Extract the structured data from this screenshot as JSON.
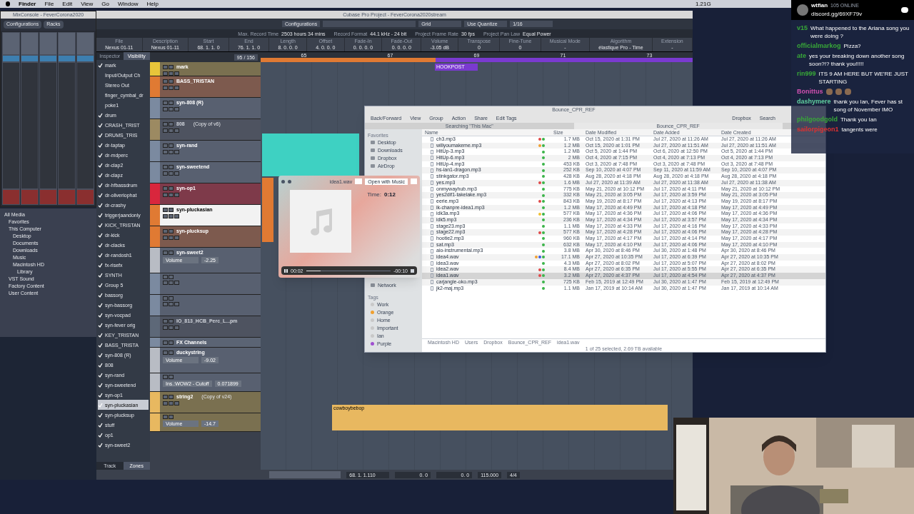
{
  "menu_bar": {
    "items": [
      "Finder",
      "File",
      "Edit",
      "View",
      "Go",
      "Window",
      "Help"
    ],
    "status": "1.21G"
  },
  "mix_console": {
    "title": "MixConsole - FeverCorona2020",
    "toolbar": [
      "Configurations",
      "Racks"
    ]
  },
  "media_browser": {
    "items": [
      {
        "label": "All Media",
        "children": [
          {
            "label": "Favorites"
          },
          {
            "label": "This Computer",
            "children": [
              {
                "label": "Desktop"
              },
              {
                "label": "Documents"
              },
              {
                "label": "Downloads"
              },
              {
                "label": "Music"
              },
              {
                "label": "Macintosh HD",
                "children": [
                  {
                    "label": "Library"
                  }
                ]
              }
            ]
          },
          {
            "label": "VST Sound"
          },
          {
            "label": "Factory Content"
          },
          {
            "label": "User Content"
          }
        ]
      }
    ]
  },
  "project": {
    "title": "Cubase Pro Project - FeverCorona2020stream",
    "toolbar": {
      "configurations": "Configurations",
      "grid": "Grid",
      "quantize": "Use Quantize",
      "quantize_value": "1/16"
    },
    "status_line": [
      {
        "label": "Max. Record Time",
        "value": "2503 hours 34 mins"
      },
      {
        "label": "Record Format",
        "value": "44.1 kHz - 24 bit"
      },
      {
        "label": "Project Frame Rate",
        "value": "30 fps"
      },
      {
        "label": "Project Pan Law",
        "value": "Equal Power"
      }
    ],
    "info_line": [
      {
        "label": "File",
        "value": "Nexus 01-11"
      },
      {
        "label": "Description",
        "value": "Nexus 01-11"
      },
      {
        "label": "Start",
        "value": "68. 1. 1. 0"
      },
      {
        "label": "End",
        "value": "76. 1. 1. 0"
      },
      {
        "label": "Length",
        "value": "8. 0. 0. 0"
      },
      {
        "label": "Offset",
        "value": "4. 0. 0. 0"
      },
      {
        "label": "Fade-In",
        "value": "0. 0. 0. 0"
      },
      {
        "label": "Fade-Out",
        "value": "0. 0. 0. 0"
      },
      {
        "label": "Volume",
        "value": "-3.05 dB"
      },
      {
        "label": "Transpose",
        "value": "0"
      },
      {
        "label": "Fine-Tune",
        "value": "0"
      },
      {
        "label": "Musical Mode",
        "value": "-"
      },
      {
        "label": "Algorithm",
        "value": "élastique Pro - Time"
      },
      {
        "label": "Extension",
        "value": "-"
      }
    ],
    "inspector_tabs": [
      {
        "label": "Inspector",
        "selected": false
      },
      {
        "label": "Visibility",
        "selected": true
      }
    ],
    "visibility": [
      {
        "name": "mark",
        "checked": true,
        "selected": false
      },
      {
        "name": "Input/Output Ch",
        "checked": false,
        "selected": false
      },
      {
        "name": "Stereo Out",
        "checked": false,
        "selected": false
      },
      {
        "name": "finger_cymbal_dr",
        "checked": false,
        "selected": false
      },
      {
        "name": "poke1",
        "checked": false,
        "selected": false
      },
      {
        "name": "drum",
        "checked": true,
        "selected": false
      },
      {
        "name": "CRASH_TRIST",
        "checked": true,
        "selected": false
      },
      {
        "name": "DRUMS_TRIS",
        "checked": true,
        "selected": false
      },
      {
        "name": "dr-taptap",
        "checked": true,
        "selected": false
      },
      {
        "name": "dr-mdperc",
        "checked": true,
        "selected": false
      },
      {
        "name": "dr-clap2",
        "checked": true,
        "selected": false
      },
      {
        "name": "dr-clapz",
        "checked": true,
        "selected": false
      },
      {
        "name": "dr-hfbassdrum",
        "checked": true,
        "selected": false
      },
      {
        "name": "dr-oliveriophat",
        "checked": true,
        "selected": false
      },
      {
        "name": "dr-crashy",
        "checked": true,
        "selected": false
      },
      {
        "name": "triggerjaandonly",
        "checked": true,
        "selected": false
      },
      {
        "name": "KICK_TRISTAN",
        "checked": true,
        "selected": false
      },
      {
        "name": "dr-kick",
        "checked": true,
        "selected": false
      },
      {
        "name": "dr-clacks",
        "checked": true,
        "selected": false
      },
      {
        "name": "dr-randosh1",
        "checked": true,
        "selected": false
      },
      {
        "name": "fx-risefx",
        "checked": true,
        "selected": false
      },
      {
        "name": "SYNTH",
        "checked": true,
        "selected": false
      },
      {
        "name": "Group 5",
        "checked": true,
        "selected": false
      },
      {
        "name": "bassorg",
        "checked": true,
        "selected": false
      },
      {
        "name": "syn-bassorg",
        "checked": true,
        "selected": false
      },
      {
        "name": "syn-vocpad",
        "checked": true,
        "selected": false
      },
      {
        "name": "syn-fever orig",
        "checked": true,
        "selected": false
      },
      {
        "name": "KEY_TRISTAN",
        "checked": true,
        "selected": false
      },
      {
        "name": "BASS_TRISTA",
        "checked": true,
        "selected": false
      },
      {
        "name": "syn-808 (R)",
        "checked": true,
        "selected": false
      },
      {
        "name": "808",
        "checked": true,
        "selected": false
      },
      {
        "name": "syn-rand",
        "checked": true,
        "selected": false
      },
      {
        "name": "syn-sweetend",
        "checked": true,
        "selected": false
      },
      {
        "name": "syn-op1",
        "checked": true,
        "selected": false
      },
      {
        "name": "syn-pluckasian",
        "checked": true,
        "selected": true
      },
      {
        "name": "syn-plucksup",
        "checked": true,
        "selected": false
      },
      {
        "name": "stuff",
        "checked": true,
        "selected": false
      },
      {
        "name": "op1",
        "checked": true,
        "selected": false
      },
      {
        "name": "syn-sweet2",
        "checked": true,
        "selected": false
      }
    ],
    "bottom_tabs": [
      {
        "label": "Track",
        "selected": false
      },
      {
        "label": "Zones",
        "selected": true
      }
    ],
    "track_counter": "95 / 156",
    "tracks": [
      {
        "kind": "marker",
        "name": "mark",
        "color": "#e8c53a",
        "selected": false
      },
      {
        "kind": "audio",
        "name": "BASS_TRISTAN",
        "color": "#e07a33",
        "selected": false
      },
      {
        "kind": "instrument",
        "name": "syn-808 (R)",
        "color": "#7b8aa0",
        "selected": false
      },
      {
        "kind": "disabled",
        "name": "808",
        "note": "(Copy of v6)",
        "color": "#9c8a62",
        "selected": false
      },
      {
        "kind": "instrument",
        "name": "syn-rand",
        "color": "#7b8aa0",
        "selected": false
      },
      {
        "kind": "instrument",
        "name": "syn-sweetend",
        "color": "#7b8aa0",
        "selected": false
      },
      {
        "kind": "instrument",
        "name": "syn-op1",
        "color": "#d9263d",
        "selected": false
      },
      {
        "kind": "instrument",
        "name": "syn-pluckasian",
        "color": "#e07a33",
        "selected": true
      },
      {
        "kind": "instrument",
        "name": "syn-plucksup",
        "color": "#e07a33",
        "selected": false
      },
      {
        "kind": "automation",
        "name": "syn-sweet2",
        "param": "Volume",
        "value": "-2.25",
        "color": "#b8bcc4",
        "selected": false
      },
      {
        "kind": "instrument",
        "color": "#7b8aa0",
        "selected": false
      },
      {
        "kind": "instrument",
        "color": "#7b8aa0",
        "selected": false
      },
      {
        "kind": "disabled",
        "name": "IO_813_HCB_Perc_L...pm",
        "color": "#5d6878",
        "selected": false
      },
      {
        "kind": "folder",
        "name": "FX Channels",
        "color": "#7b8aa0",
        "selected": false
      },
      {
        "kind": "automation",
        "name": "duckystring",
        "param": "Volume",
        "value": "-9.02",
        "color": "#b8bcc4",
        "selected": false
      },
      {
        "kind": "param",
        "param": "Ins.:WOW2 - Cutoff",
        "value": "0.071899",
        "color": "#b8bcc4",
        "selected": false
      },
      {
        "kind": "audio",
        "name": "string2",
        "note": "(Copy of v24)",
        "color": "#e8b860",
        "selected": false
      },
      {
        "kind": "param",
        "param": "Volume",
        "value": "-14.7",
        "color": "#e8b860",
        "selected": false
      }
    ],
    "ruler": [
      "65",
      "67",
      "69",
      "71",
      "73"
    ],
    "clips": [
      {
        "name": "HOOKPOST"
      },
      {
        "name": "cowboybebop"
      }
    ],
    "transport": {
      "position": "68. 1. 1.110",
      "field_a": "0. 0",
      "field_b": "0. 0",
      "tempo": "115.000",
      "signature": "4/4"
    }
  },
  "finder": {
    "title": "Bounce_CPR_REF",
    "toolbar": [
      "Back/Forward",
      "View",
      "Group",
      "Action",
      "Share",
      "Edit Tags",
      "Dropbox",
      "Search"
    ],
    "scope": "Searching \"This Mac\"",
    "tab": "Bounce_CPR_REF",
    "sidebar": [
      {
        "section": "Favorites",
        "items": [
          {
            "label": "Desktop"
          },
          {
            "label": "Downloads"
          },
          {
            "label": "Dropbox"
          },
          {
            "label": "AirDrop"
          },
          {
            "label": "Network"
          }
        ]
      },
      {
        "section": "Tags",
        "items": [
          {
            "label": "Work",
            "color": "#c8c8c8"
          },
          {
            "label": "Orange",
            "color": "#f0a030"
          },
          {
            "label": "Home",
            "color": "#c8c8c8"
          },
          {
            "label": "Important",
            "color": "#c8c8c8"
          },
          {
            "label": "Ian",
            "color": "#c8c8c8"
          },
          {
            "label": "Purple",
            "color": "#a050d0"
          }
        ]
      }
    ],
    "columns": [
      "Name",
      "Size",
      "Date Modified",
      "Date Added",
      "Date Created"
    ],
    "files": [
      {
        "name": "ch3.mp3",
        "tags": [
          {
            "color": "#e04848"
          },
          {
            "color": "#3cb44a"
          }
        ],
        "size": "1.7 MB",
        "modified": "Oct 15, 2020 at 1:31 PM",
        "added": "Jul 27, 2020 at 11:26 AM",
        "created": "Jul 27, 2020 at 11:26 AM",
        "selected": false
      },
      {
        "name": "willyoumakeme.mp3",
        "tags": [
          {
            "color": "#f0a030"
          },
          {
            "color": "#3cb44a"
          }
        ],
        "size": "1.2 MB",
        "modified": "Oct 15, 2020 at 1:01 PM",
        "added": "Jul 27, 2020 at 11:51 AM",
        "created": "Jul 27, 2020 at 11:51 AM",
        "selected": false
      },
      {
        "name": "HitUp-3.mp3",
        "tags": [
          {
            "color": "#3cb44a"
          }
        ],
        "size": "1.2 MB",
        "modified": "Oct 5, 2020 at 1:44 PM",
        "added": "Oct 6, 2020 at 12:50 PM",
        "created": "Oct 5, 2020 at 1:44 PM",
        "selected": false
      },
      {
        "name": "HitUp-6.mp3",
        "tags": [
          {
            "color": "#3cb44a"
          }
        ],
        "size": "2 MB",
        "modified": "Oct 4, 2020 at 7:15 PM",
        "added": "Oct 4, 2020 at 7:13 PM",
        "created": "Oct 4, 2020 at 7:13 PM",
        "selected": false
      },
      {
        "name": "HitUp-4.mp3",
        "tags": [
          {
            "color": "#3cb44a"
          }
        ],
        "size": "453 KB",
        "modified": "Oct 3, 2020 at 7:48 PM",
        "added": "Oct 3, 2020 at 7:48 PM",
        "created": "Oct 3, 2020 at 7:48 PM",
        "selected": false
      },
      {
        "name": "hs-ian1-dragon.mp3",
        "tags": [
          {
            "color": "#3cb44a"
          }
        ],
        "size": "252 KB",
        "modified": "Sep 10, 2020 at 4:07 PM",
        "added": "Sep 11, 2020 at 11:59 AM",
        "created": "Sep 10, 2020 at 4:07 PM",
        "selected": false
      },
      {
        "name": "stinkgator.mp3",
        "tags": [
          {
            "color": "#3cb44a"
          }
        ],
        "size": "428 KB",
        "modified": "Aug 28, 2020 at 4:18 PM",
        "added": "Aug 28, 2020 at 4:18 PM",
        "created": "Aug 28, 2020 at 4:18 PM",
        "selected": false
      },
      {
        "name": "yes.mp3",
        "tags": [
          {
            "color": "#e04848"
          },
          {
            "color": "#3cb44a"
          }
        ],
        "size": "1.6 MB",
        "modified": "Jul 27, 2020 at 11:39 AM",
        "added": "Jul 27, 2020 at 11:38 AM",
        "created": "Jul 27, 2020 at 11:38 AM",
        "selected": false
      },
      {
        "name": "onmywayhub.mp3",
        "tags": [
          {
            "color": "#3cb44a"
          }
        ],
        "size": "775 KB",
        "modified": "May 21, 2020 at 10:12 PM",
        "added": "Jul 17, 2020 at 4:11 PM",
        "created": "May 21, 2020 at 10:12 PM",
        "selected": false
      },
      {
        "name": "yes2dif1-takelake.mp3",
        "tags": [
          {
            "color": "#3cb44a"
          }
        ],
        "size": "332 KB",
        "modified": "May 21, 2020 at 3:05 PM",
        "added": "Jul 17, 2020 at 3:59 PM",
        "created": "May 21, 2020 at 3:05 PM",
        "selected": false
      },
      {
        "name": "eerie.mp3",
        "tags": [
          {
            "color": "#e04848"
          },
          {
            "color": "#3cb44a"
          }
        ],
        "size": "843 KB",
        "modified": "May 19, 2020 at 8:17 PM",
        "added": "Jul 17, 2020 at 4:13 PM",
        "created": "May 19, 2020 at 8:17 PM",
        "selected": false
      },
      {
        "name": "ik-chanpre-idea1.mp3",
        "tags": [
          {
            "color": "#3cb44a"
          }
        ],
        "size": "1.2 MB",
        "modified": "May 17, 2020 at 4:49 PM",
        "added": "Jul 17, 2020 at 4:18 PM",
        "created": "May 17, 2020 at 4:49 PM",
        "selected": false
      },
      {
        "name": "idk3a.mp3",
        "tags": [
          {
            "color": "#f0c030"
          },
          {
            "color": "#3cb44a"
          }
        ],
        "size": "577 KB",
        "modified": "May 17, 2020 at 4:36 PM",
        "added": "Jul 17, 2020 at 4:06 PM",
        "created": "May 17, 2020 at 4:36 PM",
        "selected": false
      },
      {
        "name": "idk5.mp3",
        "tags": [
          {
            "color": "#3cb44a"
          }
        ],
        "size": "236 KB",
        "modified": "May 17, 2020 at 4:34 PM",
        "added": "Jul 17, 2020 at 3:57 PM",
        "created": "May 17, 2020 at 4:34 PM",
        "selected": false
      },
      {
        "name": "stage23.mp3",
        "tags": [
          {
            "color": "#3cb44a"
          }
        ],
        "size": "1.1 MB",
        "modified": "May 17, 2020 at 4:33 PM",
        "added": "Jul 17, 2020 at 4:16 PM",
        "created": "May 17, 2020 at 4:33 PM",
        "selected": false
      },
      {
        "name": "stage22.mp3",
        "tags": [
          {
            "color": "#e04848"
          },
          {
            "color": "#3cb44a"
          }
        ],
        "size": "577 KB",
        "modified": "May 17, 2020 at 4:28 PM",
        "added": "Jul 17, 2020 at 4:06 PM",
        "created": "May 17, 2020 at 4:28 PM",
        "selected": false
      },
      {
        "name": "hootie2.mp3",
        "tags": [
          {
            "color": "#3cb44a"
          }
        ],
        "size": "960 KB",
        "modified": "May 17, 2020 at 4:17 PM",
        "added": "Jul 17, 2020 at 4:14 PM",
        "created": "May 17, 2020 at 4:17 PM",
        "selected": false
      },
      {
        "name": "sat.mp3",
        "tags": [
          {
            "color": "#3cb44a"
          }
        ],
        "size": "632 KB",
        "modified": "May 17, 2020 at 4:10 PM",
        "added": "Jul 17, 2020 at 4:06 PM",
        "created": "May 17, 2020 at 4:10 PM",
        "selected": false
      },
      {
        "name": "aio-instrumental.mp3",
        "tags": [
          {
            "color": "#3cb44a"
          }
        ],
        "size": "3.8 MB",
        "modified": "Apr 30, 2020 at 8:46 PM",
        "added": "Jul 30, 2020 at 1:48 PM",
        "created": "Apr 30, 2020 at 8:46 PM",
        "selected": false
      },
      {
        "name": "idea4.wav",
        "tags": [
          {
            "color": "#f0a030"
          },
          {
            "color": "#3c5ce0"
          },
          {
            "color": "#3cb44a"
          }
        ],
        "size": "17.1 MB",
        "modified": "Apr 27, 2020 at 10:35 PM",
        "added": "Jul 17, 2020 at 6:39 PM",
        "created": "Apr 27, 2020 at 10:35 PM",
        "selected": false
      },
      {
        "name": "idea3.wav",
        "tags": [
          {
            "color": "#3cb44a"
          }
        ],
        "size": "4.3 MB",
        "modified": "Apr 27, 2020 at 8:02 PM",
        "added": "Jul 17, 2020 at 5:07 PM",
        "created": "Apr 27, 2020 at 8:02 PM",
        "selected": false
      },
      {
        "name": "idea2.wav",
        "tags": [
          {
            "color": "#e04848"
          },
          {
            "color": "#3cb44a"
          }
        ],
        "size": "8.4 MB",
        "modified": "Apr 27, 2020 at 6:35 PM",
        "added": "Jul 17, 2020 at 5:55 PM",
        "created": "Apr 27, 2020 at 6:35 PM",
        "selected": false
      },
      {
        "name": "idea1.wav",
        "tags": [
          {
            "color": "#e04848"
          },
          {
            "color": "#3cb44a"
          }
        ],
        "size": "3.2 MB",
        "modified": "Apr 27, 2020 at 4:37 PM",
        "added": "Jul 17, 2020 at 4:54 PM",
        "created": "Apr 27, 2020 at 4:37 PM",
        "selected": true
      },
      {
        "name": "carjangle-oko.mp3",
        "tags": [
          {
            "color": "#3cb44a"
          }
        ],
        "size": "725 KB",
        "modified": "Feb 15, 2019 at 12:49 PM",
        "added": "Jul 30, 2020 at 1:47 PM",
        "created": "Feb 15, 2019 at 12:49 PM",
        "selected": false
      },
      {
        "name": "jk2-maj.mp3",
        "tags": [
          {
            "color": "#3cb44a"
          }
        ],
        "size": "1.1 MB",
        "modified": "Jan 17, 2019 at 10:14 AM",
        "added": "Jul 30, 2020 at 1:47 PM",
        "created": "Jan 17, 2019 at 10:14 AM",
        "selected": false
      }
    ],
    "path": [
      "Macintosh HD",
      "Users",
      "Dropbox",
      "Bounce_CPR_REF",
      "idea1.wav"
    ],
    "status": "1 of 25 selected, 2.69 TB available"
  },
  "quick_look": {
    "file": "idea1.wav",
    "open_button": "Open with Music",
    "time_label": "Time:",
    "time": "0:12",
    "elapsed": "00:02",
    "remaining": "-00:10",
    "level": 0.17
  },
  "chat": {
    "channel": "wtfian",
    "online": "105 ONLINE",
    "invite": "discord.gg/69XF79v",
    "messages": [
      {
        "user": "v15",
        "color": "#38a838",
        "text": "What happened to the Ariana song you were doing ?"
      },
      {
        "user": "officialmarkog",
        "color": "#38a838",
        "text": "Pizza?"
      },
      {
        "user": "ate",
        "color": "#38a838",
        "text": "yes your breaking down another song soon?!? thank you!!!!!"
      },
      {
        "user": "rin999",
        "color": "#38a838",
        "text": "ITS 9 AM HERE BUT WE'RE JUST STARTING"
      },
      {
        "user": "Bonittus",
        "color": "#d050b0"
      },
      {
        "user": "dashymere",
        "color": "#60d0a0",
        "text": "thank you Ian, Fever has st song of November IMO"
      },
      {
        "user": "philgoodgold",
        "color": "#38a838",
        "text": "Thank you Ian"
      },
      {
        "user": "sailorpigeon1",
        "color": "#e03030",
        "text": "tangents were"
      }
    ]
  }
}
